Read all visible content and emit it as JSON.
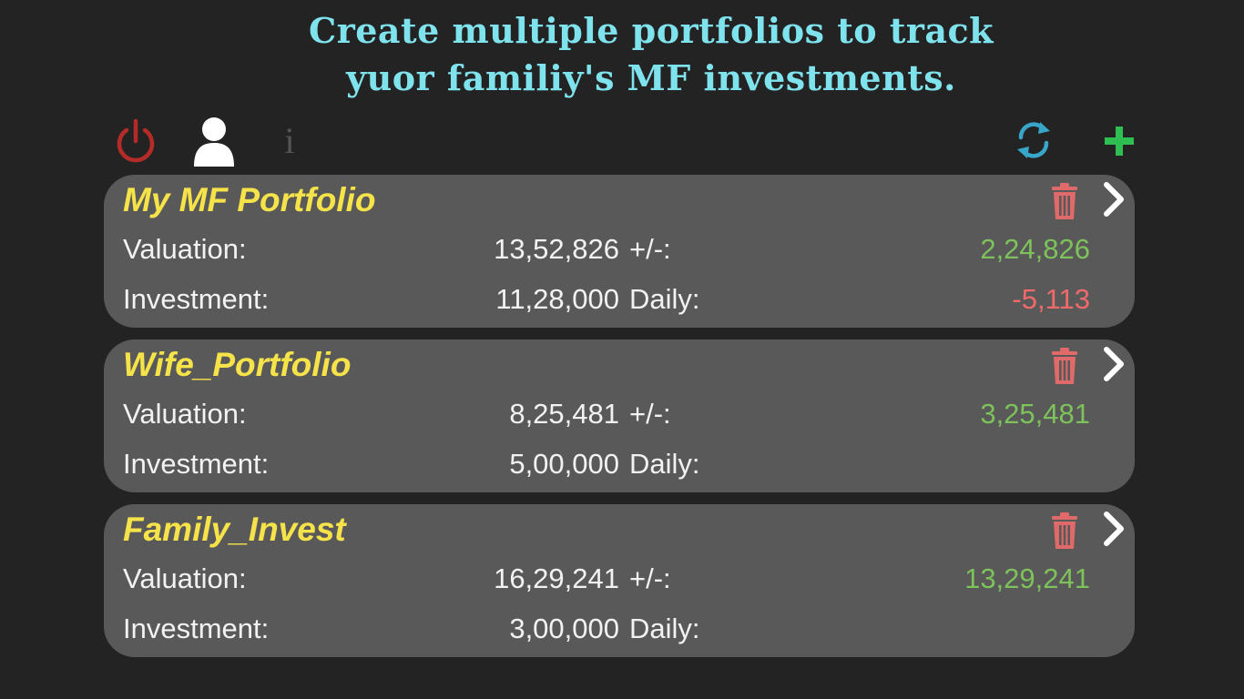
{
  "promo": {
    "line1": "Create multiple portfolios to track",
    "line2": "yuor familiy's MF investments."
  },
  "toolbar": {
    "info_label": "i",
    "icons": [
      "power-icon",
      "user-icon",
      "info-icon",
      "refresh-icon",
      "plus-icon"
    ]
  },
  "colors": {
    "background": "#232323",
    "card": "#595959",
    "portfolio_name": "#f6e34a",
    "caption": "#7fe3ee",
    "gain": "#7dc25a",
    "loss": "#ef6b6b",
    "power": "#b52b28",
    "refresh": "#38a6c8",
    "add": "#2fbe52",
    "trash": "#e06a6a"
  },
  "labels": {
    "valuation": "Valuation:",
    "investment": "Investment:",
    "change": "+/-:",
    "daily": "Daily:"
  },
  "portfolios": [
    {
      "name": "My MF Portfolio",
      "valuation": "13,52,826",
      "investment": "11,28,000",
      "change": "2,24,826",
      "daily": "-5,113"
    },
    {
      "name": "Wife_Portfolio",
      "valuation": "8,25,481",
      "investment": "5,00,000",
      "change": "3,25,481",
      "daily": ""
    },
    {
      "name": "Family_Invest",
      "valuation": "16,29,241",
      "investment": "3,00,000",
      "change": "13,29,241",
      "daily": ""
    }
  ]
}
